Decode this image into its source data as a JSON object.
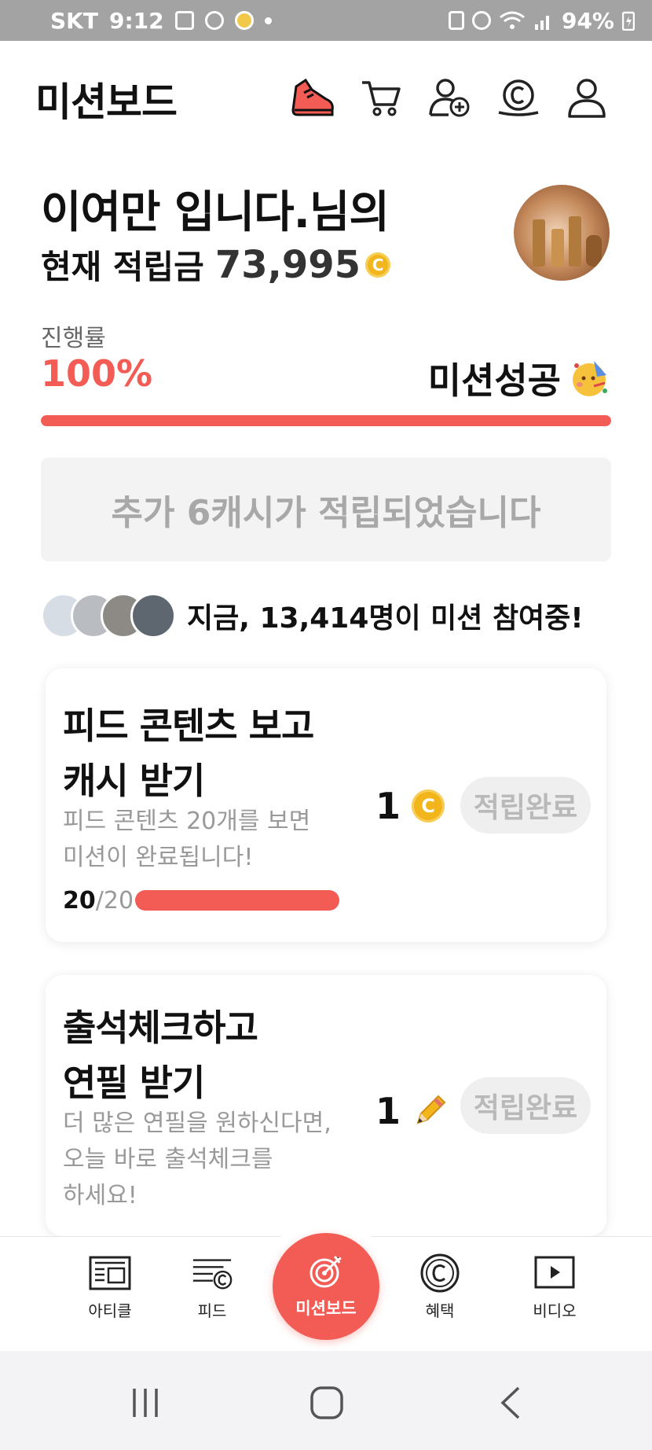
{
  "status_bar": {
    "carrier": "SKT",
    "time": "9:12",
    "battery": "94%"
  },
  "header": {
    "title": "미션보드",
    "icons": [
      "sneaker-icon",
      "cart-icon",
      "add-friend-icon",
      "coin-icon",
      "profile-icon"
    ]
  },
  "greeting": {
    "name": "이여만 입니다.님의",
    "balance_label": "현재 적립금",
    "balance_value": "73,995",
    "coin_symbol": "C"
  },
  "progress": {
    "label": "진행률",
    "value": "100%",
    "fraction": 1.0,
    "status": "미션성공"
  },
  "notice": "추가 6캐시가 적립되었습니다",
  "participants": {
    "prefix": "지금,",
    "count": "13,414명",
    "suffix": "이 미션 참여중!"
  },
  "missions": [
    {
      "title_line1": "피드 콘텐츠 보고",
      "title_line2": "캐시 받기",
      "desc_line1": "피드 콘텐츠 20개를 보면",
      "desc_line2": "미션이 완료됩니다!",
      "reward": "1",
      "reward_icon": "coin-icon",
      "button": "적립완료",
      "progress_done": "20",
      "progress_total": "/20",
      "progress_fraction": 1.0
    },
    {
      "title_line1": "출석체크하고",
      "title_line2": "연필 받기",
      "desc_line1": "더 많은 연필을 원하신다면,",
      "desc_line2": "오늘 바로 출석체크를",
      "desc_line3": "하세요!",
      "reward": "1",
      "reward_icon": "pencil-icon",
      "button": "적립완료"
    }
  ],
  "bottom_nav": {
    "items": [
      {
        "label": "아티클",
        "icon": "article-icon"
      },
      {
        "label": "피드",
        "icon": "feed-icon"
      },
      {
        "label": "미션보드",
        "icon": "target-icon"
      },
      {
        "label": "혜택",
        "icon": "benefit-coin-icon"
      },
      {
        "label": "비디오",
        "icon": "video-icon"
      }
    ]
  },
  "colors": {
    "accent": "#f25c54",
    "coin": "#f2b51c",
    "status_bar": "#a3a3a3",
    "muted_text": "#999999"
  }
}
